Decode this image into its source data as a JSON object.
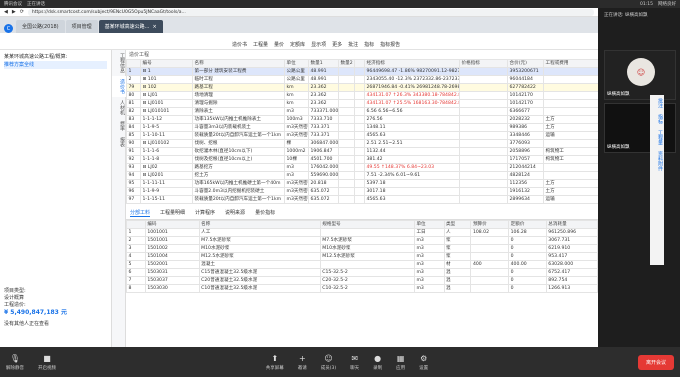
{
  "topbar": {
    "left": [
      "腾讯会议",
      "正在讲话"
    ],
    "right": [
      "01:15",
      "网络良好"
    ]
  },
  "address": {
    "url": "https://dsk.smartcost.com/subject/9ENcU0G5Opu5JNCaaGt/tools/a..."
  },
  "tabs": [
    "全国公路(2018)",
    "项目管理",
    "基某环城高速公路..."
  ],
  "toolbar": [
    "造价书",
    "工程量",
    "量价",
    "定额库",
    "显示项",
    "更多",
    "批注",
    "指标",
    "指标报告"
  ],
  "left": {
    "tree": [
      "某某环城高速公路工程/概算:",
      "推荐方案全线"
    ],
    "info": [
      "项目类型:",
      "设计概算",
      "工程造价:",
      "¥ 5,490,847,183 元",
      "没有其他人正在查看"
    ]
  },
  "vtabs": [
    "工程信息",
    "造价书",
    "人材机",
    "费率",
    "报表"
  ],
  "breadcrumb": "造价工程",
  "headers": [
    "",
    "编号",
    "名称",
    "单位",
    "数量1",
    "数量2",
    "",
    "经济指标",
    "价格指标",
    "合价(元)",
    "工程或费用"
  ],
  "rows": [
    {
      "c": "hl",
      "v": [
        "1",
        "⊟ 1",
        "第一部分 建筑安装工程费",
        "公路公里",
        "48.991",
        "",
        "",
        "96449698.47 -1.86% 98270091.12-98270091.12",
        "",
        "3953200671",
        ""
      ]
    },
    {
      "c": "",
      "v": [
        "2",
        "⊞ 101",
        "临时工程",
        "公路公里",
        "48.991",
        "",
        "",
        "2343055.40 -12.3% 2372332.86-2372332.86",
        "",
        "96044184",
        ""
      ]
    },
    {
      "c": "yl",
      "v": [
        "79",
        "⊟ 102",
        "路基工程",
        "km",
        "23.362",
        "",
        "",
        "26871946.84 -0.41% 26981248.78-26981248.78",
        "",
        "627782422",
        ""
      ]
    },
    {
      "c": "",
      "v": [
        "80",
        "⊟ LJ01",
        "场地清理",
        "km",
        "23.362",
        "",
        "",
        "434131.07 ↑26.3% 343380.18-784842.86",
        "",
        "10142170",
        ""
      ]
    },
    {
      "c": "",
      "v": [
        "81",
        "⊟ LJ0101",
        "清理与掘除",
        "km",
        "23.362",
        "",
        "",
        "434131.07 ↑25.5% 168163.30-784842.86",
        "",
        "10142170",
        ""
      ]
    },
    {
      "c": "",
      "v": [
        "82",
        "⊟ LJ010101",
        "清除表土",
        "m3",
        "733371.000",
        "",
        "",
        "6.56 6.56~6.56",
        "",
        "6366677",
        ""
      ]
    },
    {
      "c": "",
      "v": [
        "83",
        "1-1-1-12",
        "功率135kW以内推土机推除表土",
        "100m3",
        "7333.710",
        "",
        "",
        "276.56",
        "",
        "2028232",
        "土方"
      ]
    },
    {
      "c": "",
      "v": [
        "84",
        "1-1-9-5",
        "斗容量3m3以内装载机装土",
        "m3天然密实",
        "733.371",
        "",
        "",
        "1348.11",
        "",
        "989386",
        "土方"
      ]
    },
    {
      "c": "",
      "v": [
        "85",
        "1-1-10-11",
        "装载质量20t以内自卸汽车运土第一个1km",
        "m3天然密实",
        "733.371",
        "",
        "",
        "4565.63",
        "",
        "3348446",
        "运输"
      ]
    },
    {
      "c": "",
      "v": [
        "90",
        "⊟ LJ010102",
        "伐树、挖根",
        "棵",
        "306847.000",
        "",
        "",
        "2.51 2.51~2.51",
        "",
        "3776093",
        ""
      ]
    },
    {
      "c": "",
      "v": [
        "91",
        "1-1-1-6",
        "砍挖灌木林(直径10cm以下)",
        "1000m2",
        "1906.847",
        "",
        "",
        "1132.44",
        "",
        "2058896",
        "构筑物工"
      ]
    },
    {
      "c": "",
      "v": [
        "92",
        "1-1-1-8",
        "伐树及挖根(直径10cm以上)",
        "10棵",
        "4501.700",
        "",
        "",
        "381.42",
        "",
        "1717057",
        "构筑物工"
      ]
    },
    {
      "c": "",
      "v": [
        "93",
        "⊟ LJ02",
        "路基挖方",
        "m3",
        "176042.000",
        "",
        "",
        "49.55 ↑148.37% 6.84~23.03",
        "",
        "212044214",
        ""
      ]
    },
    {
      "c": "",
      "v": [
        "94",
        "⊟ LJ0201",
        "挖土方",
        "m3",
        "559690.000",
        "",
        "",
        "7.51 -2.34% 6.01~9.61",
        "",
        "4828124",
        ""
      ]
    },
    {
      "c": "",
      "v": [
        "95",
        "1-1-11-11",
        "功率165kW以内推土机推硬土第一个40m",
        "m3天然密实",
        "20.818",
        "",
        "",
        "5397.18",
        "",
        "112356",
        "土方"
      ]
    },
    {
      "c": "",
      "v": [
        "96",
        "1-1-9-9",
        "斗容量2.0m3以内挖掘机挖装硬土",
        "m3天然密实",
        "635.072",
        "",
        "",
        "3017.18",
        "",
        "1916132",
        "土方"
      ]
    },
    {
      "c": "",
      "v": [
        "97",
        "1-1-15-11",
        "装载质量20t以内自卸汽车运土第一个1km",
        "m3天然密实",
        "635.072",
        "",
        "",
        "4565.63",
        "",
        "2899634",
        "运输"
      ]
    }
  ],
  "bottomtabs": [
    "分部工料",
    "工程量明细",
    "计算程序",
    "说明来源",
    "量价指标"
  ],
  "bheaders": [
    "",
    "编码",
    "名称",
    "规格型号",
    "单位",
    "类型",
    "预算价",
    "定额价",
    "总消耗量"
  ],
  "brows": [
    [
      "1",
      "1001001",
      "人工",
      "",
      "工日",
      "人",
      "108.02",
      "106.28",
      "961250.896"
    ],
    [
      "2",
      "1501001",
      "M7.5水泥砂浆",
      "M7.5水泥砂浆",
      "m3",
      "浆",
      "",
      "0",
      "3067.731"
    ],
    [
      "3",
      "1501002",
      "M10水泥砂浆",
      "M10水泥砂浆",
      "m3",
      "浆",
      "",
      "0",
      "6219.910"
    ],
    [
      "4",
      "1501004",
      "M12.5水泥砂浆",
      "M12.5水泥砂浆",
      "m3",
      "浆",
      "",
      "0",
      "953.417"
    ],
    [
      "5",
      "1502001",
      "混凝土",
      "",
      "m3",
      "材",
      "400",
      "400.00",
      "63028.000"
    ],
    [
      "6",
      "1503031",
      "C15普通混凝土32.5级水泥",
      "C15-32.5-2",
      "m3",
      "混",
      "",
      "0",
      "6752.417"
    ],
    [
      "7",
      "1503037",
      "C20普通混凝土32.5级水泥",
      "C20-32.5-2",
      "m3",
      "混",
      "",
      "0",
      "892.754"
    ],
    [
      "8",
      "1503030",
      "C10普通混凝土32.5级水泥",
      "C10-32.5-2",
      "m3",
      "混",
      "",
      "0",
      "1266.913"
    ]
  ],
  "rightpanel": {
    "status": "正在讲话:",
    "speaker": " 纵横高如飘",
    "v1": "纵横高如飘",
    "v2": "纵横高如飘"
  },
  "sidenote": [
    "批注",
    "指标",
    "工程量",
    "资料附件"
  ],
  "bottombar": [
    "解除静音",
    "开启视频",
    "共享屏幕",
    "邀请",
    "成员(3)",
    "聊天",
    "录制",
    "应用",
    "设置"
  ],
  "endbtn": "离开会议"
}
